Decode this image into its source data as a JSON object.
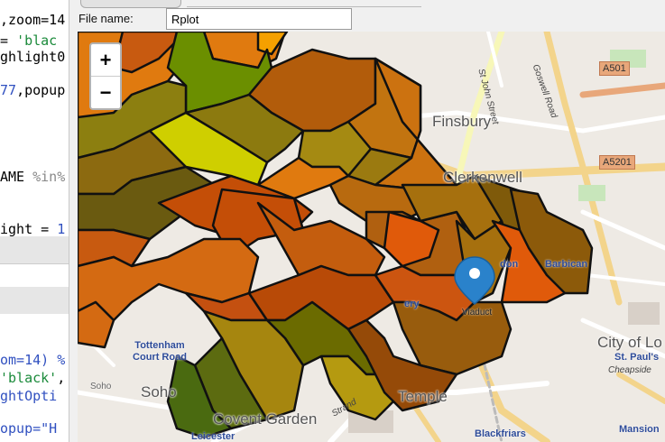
{
  "editor": {
    "lines": [
      {
        "pre": ",zoom=14",
        "str": "",
        "post": ""
      },
      {
        "pre": " = ",
        "str": "'blac",
        "post": ""
      },
      {
        "pre": "ghlight0",
        "str": "",
        "post": ""
      },
      {
        "pre": "",
        "num": "77",
        "post": ",popup"
      },
      {
        "pre": "AME ",
        "cmt": "%in%",
        "post": ""
      },
      {
        "pre": "ight = ",
        "num": "1",
        "post": ""
      },
      {
        "pre": "om=14) %",
        "str": "",
        "post": ""
      },
      {
        "pre": "",
        "str": "'black'",
        "post": ","
      },
      {
        "pre": "ghtOpti",
        "str": "",
        "post": ""
      },
      {
        "pre": "opup=\"H",
        "str": "",
        "post": ""
      }
    ]
  },
  "viewer": {
    "filename_label": "File name:",
    "filename_value": "Rplot"
  },
  "map": {
    "zoom_in": "+",
    "zoom_out": "−",
    "marker_icon": "map-pin-icon",
    "labels": {
      "finsbury": "Finsbury",
      "clerkenwell": "Clerkenwell",
      "city": "City of Lo",
      "temple": "Temple",
      "soho": "Soho",
      "soho2": "Soho",
      "covent": "Covent Garden",
      "barbican": "Barbican",
      "viaduct": "Viaduct",
      "tottenham": "Tottenham Court Road",
      "stpauls": "St. Paul's",
      "cheapside": "Cheapside",
      "blackfriars": "Blackfriars",
      "leicester": "Leicester",
      "mansion": "Mansion",
      "don": "don",
      "ery": "ery",
      "stjohn": "St John Street",
      "goswell": "Goswell Road",
      "strand": "Strand",
      "a501": "A501",
      "a5201": "A5201"
    }
  }
}
